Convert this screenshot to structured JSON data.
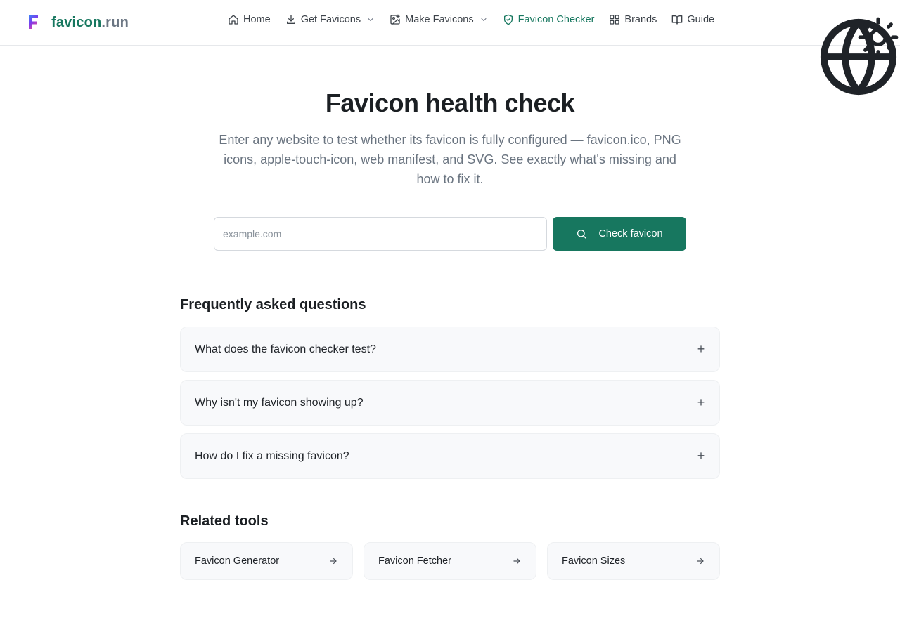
{
  "brand": {
    "name_part1": "favicon",
    "name_part2": ".run",
    "logo_letter": "F"
  },
  "nav": {
    "items": [
      {
        "label": "Home",
        "icon": "home-icon"
      },
      {
        "label": "Get Favicons",
        "icon": "download-icon",
        "dropdown": true
      },
      {
        "label": "Make Favicons",
        "icon": "image-plus-icon",
        "dropdown": true
      },
      {
        "label": "Favicon Checker",
        "icon": "shield-check-icon",
        "active": true
      },
      {
        "label": "Brands",
        "icon": "grid-icon"
      },
      {
        "label": "Guide",
        "icon": "book-icon"
      }
    ],
    "right_icons": [
      "globe-icon",
      "sun-icon"
    ]
  },
  "hero": {
    "title": "Favicon health check",
    "description": "Enter any website to test whether its favicon is fully configured — favicon.ico, PNG icons, apple-touch-icon, web manifest, and SVG. See exactly what's missing and how to fix it."
  },
  "search": {
    "placeholder": "example.com",
    "value": "",
    "button_label": "Check favicon"
  },
  "faq": {
    "title": "Frequently asked questions",
    "items": [
      {
        "question": "What does the favicon checker test?"
      },
      {
        "question": "Why isn't my favicon showing up?"
      },
      {
        "question": "How do I fix a missing favicon?"
      }
    ],
    "toggle_symbol": "+"
  },
  "related": {
    "title": "Related tools",
    "items": [
      {
        "label": "Favicon Generator"
      },
      {
        "label": "Favicon Fetcher"
      },
      {
        "label": "Favicon Sizes"
      }
    ]
  },
  "colors": {
    "accent": "#17775f",
    "muted_text": "#6a7480",
    "card_bg": "#f8f9fb"
  }
}
